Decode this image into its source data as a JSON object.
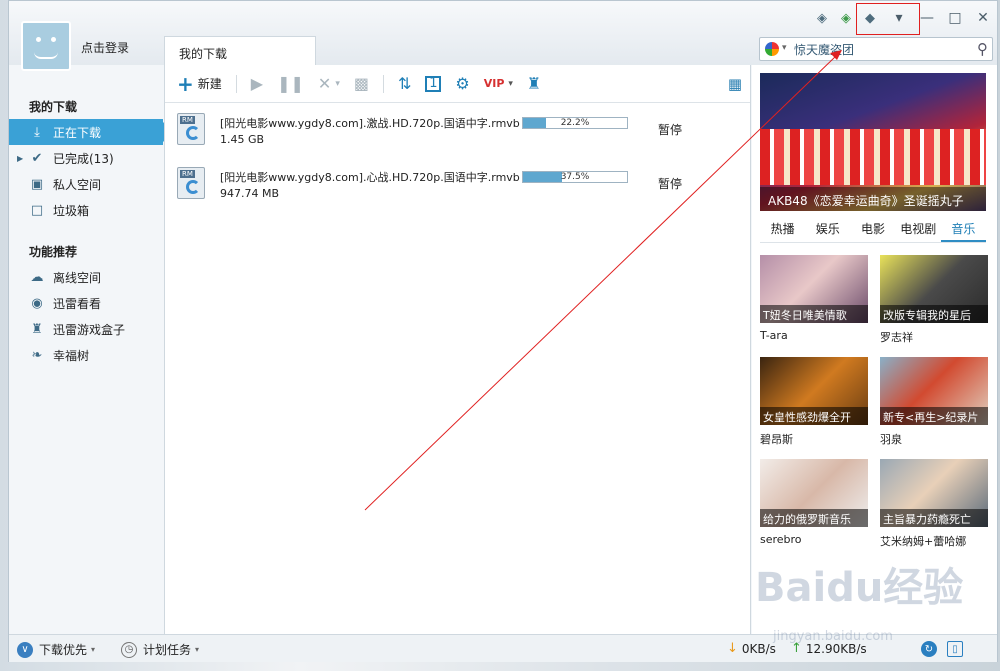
{
  "user": {
    "login_label": "点击登录"
  },
  "tabs": {
    "main": "我的下载"
  },
  "search": {
    "value": "惊天魔盗团"
  },
  "sidebar": {
    "section_downloads": "我的下载",
    "items": [
      {
        "label": "正在下载"
      },
      {
        "label": "已完成(13)"
      },
      {
        "label": "私人空间"
      },
      {
        "label": "垃圾箱"
      }
    ],
    "section_features": "功能推荐",
    "features": [
      {
        "label": "离线空间"
      },
      {
        "label": "迅雷看看"
      },
      {
        "label": "迅雷游戏盒子"
      },
      {
        "label": "幸福树"
      }
    ]
  },
  "toolbar": {
    "new_label": "新建"
  },
  "downloads": [
    {
      "name": "[阳光电影www.ygdy8.com].激战.HD.720p.国语中字.rmvb",
      "size": "1.45 GB",
      "progress_text": "22.2%",
      "progress": 0.222,
      "status": "暂停"
    },
    {
      "name": "[阳光电影www.ygdy8.com].心战.HD.720p.国语中字.rmvb",
      "size": "947.74 MB",
      "progress_text": "37.5%",
      "progress": 0.375,
      "status": "暂停"
    }
  ],
  "right_panel": {
    "banner_caption": "AKB48《恋爱幸运曲奇》圣诞摇丸子",
    "tabs": [
      "热播",
      "娱乐",
      "电影",
      "电视剧",
      "音乐"
    ],
    "cards": [
      {
        "caption": "T妞冬日唯美情歌",
        "label": "T-ara"
      },
      {
        "caption": "改版专辑我的星后",
        "label": "罗志祥"
      },
      {
        "caption": "女皇性感劲爆全开",
        "label": "碧昂斯"
      },
      {
        "caption": "新专<再生>纪录片",
        "label": "羽泉"
      },
      {
        "caption": "给力的俄罗斯音乐",
        "label": "serebro"
      },
      {
        "caption": "主旨暴力药瘾死亡",
        "label": "艾米纳姆+蕾哈娜"
      }
    ]
  },
  "statusbar": {
    "priority": "下载优先",
    "plan": "计划任务",
    "down_speed": "0KB/s",
    "up_speed": "12.90KB/s"
  },
  "watermark": {
    "main": "Baidu经验",
    "sub": "jingyan.baidu.com"
  },
  "colors": {
    "accent": "#3aa1d6",
    "annotation": "#e02020"
  }
}
